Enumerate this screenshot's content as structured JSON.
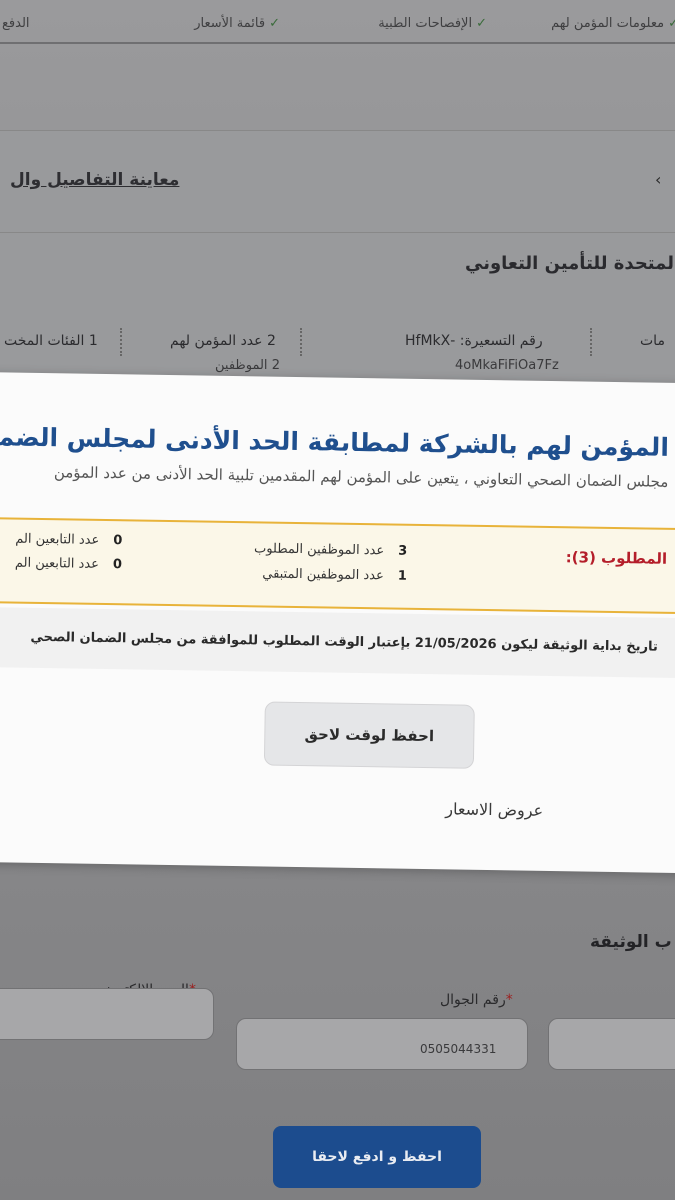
{
  "stepper": {
    "steps": [
      "معلومات المؤمن لهم",
      "الإفصاحات الطبية",
      "قائمة الأسعار",
      "الدفع"
    ]
  },
  "background": {
    "review_link": "معاينة التفاصيل وال",
    "company": "المتحدة للتأمين التعاوني",
    "pricing_label": "رقم التسعيرة: -HfMkX",
    "pricing_value": "4oMkaFiFiOa7Fz",
    "insured_count": "2 عدد المؤمن لهم",
    "insured_sub": "2 الموظفين",
    "categories": "1 الفئات المخت",
    "left_edge_text": "مات"
  },
  "modal": {
    "title": "المؤمن لهم بالشركة لمطابقة الحد الأدنى لمجلس الضمان الصحي",
    "subtitle": "مجلس الضمان الصحي التعاوني ، يتعين على المؤمن لهم المقدمين تلبية الحد الأدنى من عدد المؤمن",
    "required_label": "المطلوب (3):",
    "required_employees": {
      "num": "3",
      "label": "عدد الموظفين المطلوب"
    },
    "remaining_employees": {
      "num": "1",
      "label": "عدد الموظفين المتبقي"
    },
    "dependents_1": {
      "num": "0",
      "label": "عدد التابعين الم"
    },
    "dependents_2": {
      "num": "0",
      "label": "عدد التابعين الم"
    },
    "note": "تاريخ بداية الوثيقة ليكون 21/05/2026 بإعتبار الوقت المطلوب للموافقة من مجلس الضمان الصحي",
    "save_later": "احفظ لوقت لاحق",
    "offers": "عروض الاسعار"
  },
  "form": {
    "section_title": "ب الوثيقة",
    "mobile_label": "رقم الجوال",
    "mobile_value": "0505044331",
    "email_label": "البريد الالكتروني"
  },
  "footer": {
    "save_pay": "احفظ و ادفع لاحقا"
  }
}
